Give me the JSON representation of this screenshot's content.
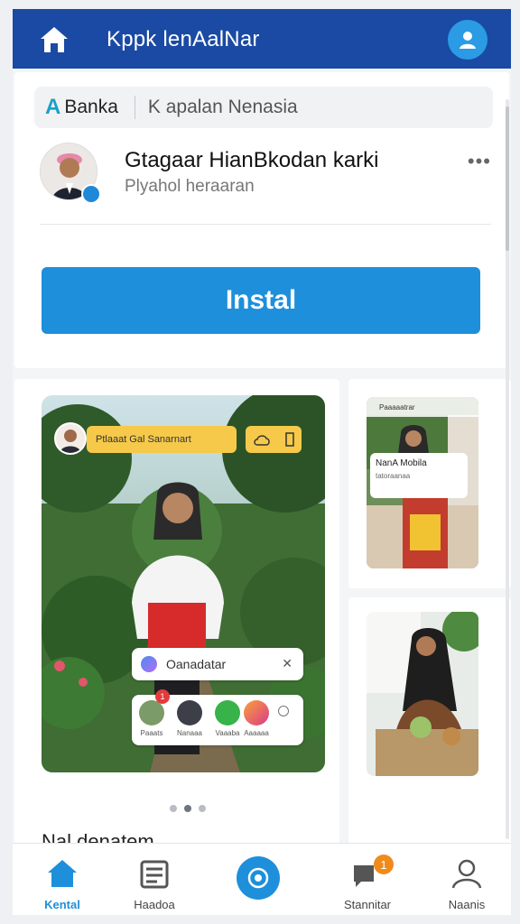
{
  "topbar": {
    "title": "Kppk lenAalNar",
    "icons": {
      "home": "home-icon",
      "profile": "user-icon"
    },
    "colors": {
      "background": "#1a4aa3",
      "accent": "#2a9be4"
    }
  },
  "search": {
    "brand_initial": "A",
    "brand": "Banka",
    "query": "K apalan Nenasia"
  },
  "profile": {
    "name": "Gtagaar HianBkodan karki",
    "subtitle": "Plyahol heraaran",
    "more": "•••"
  },
  "install_button": {
    "label": "Instal",
    "color": "#1e8fdb"
  },
  "main_post": {
    "tag_banner": "Ptlaaat Gal Sanarnart",
    "connect_chip": "Oanadatar",
    "share_labels": [
      "Paaats",
      "Nanaaa",
      "Vaaaba",
      "Aaaaaa"
    ],
    "share_badge": "1",
    "caption": "Nal denatem.",
    "carousel": {
      "count": 3,
      "active": 1
    }
  },
  "side_post_1": {
    "header": "Paaaaatrar",
    "popup_title": "NanA Mobila",
    "popup_sub": "tatoraanaa"
  },
  "side_post_2": {},
  "bottom_nav": {
    "items": [
      {
        "label": "Kental",
        "icon": "home-icon",
        "active": true
      },
      {
        "label": "Haadoa",
        "icon": "store-icon",
        "active": false
      },
      {
        "label": "",
        "icon": "camera-icon",
        "active": false
      },
      {
        "label": "Stannitar",
        "icon": "chat-icon",
        "active": false,
        "badge": "1"
      },
      {
        "label": "Naanis",
        "icon": "user-icon",
        "active": false
      }
    ]
  }
}
